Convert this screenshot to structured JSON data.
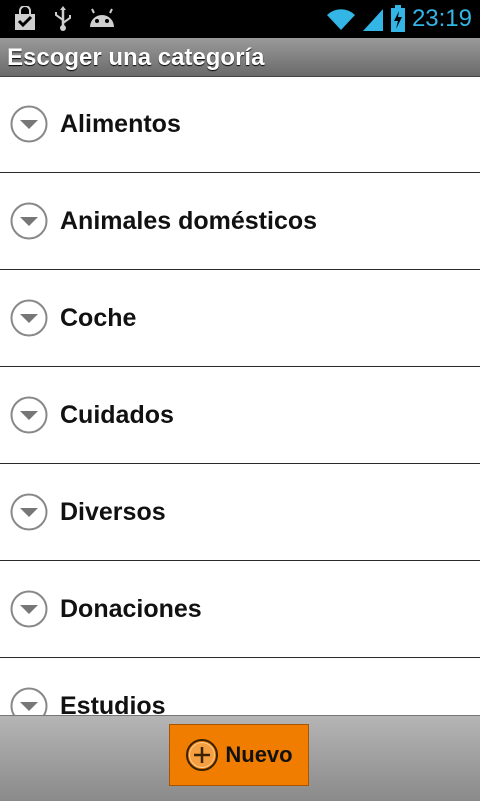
{
  "status_bar": {
    "time": "23:19",
    "icons": [
      "shopping-bag-icon",
      "usb-icon",
      "android-debug-icon",
      "wifi-icon",
      "signal-icon",
      "battery-charging-icon"
    ],
    "accent_color": "#33b5e5"
  },
  "title_bar": {
    "title": "Escoger una categoría"
  },
  "categories": [
    {
      "label": "Alimentos",
      "icon": "chevron-down-circle-icon"
    },
    {
      "label": "Animales domésticos",
      "icon": "chevron-down-circle-icon"
    },
    {
      "label": "Coche",
      "icon": "chevron-down-circle-icon"
    },
    {
      "label": "Cuidados",
      "icon": "chevron-down-circle-icon"
    },
    {
      "label": "Diversos",
      "icon": "chevron-down-circle-icon"
    },
    {
      "label": "Donaciones",
      "icon": "chevron-down-circle-icon"
    },
    {
      "label": "Estudios",
      "icon": "chevron-down-circle-icon"
    }
  ],
  "bottom_bar": {
    "new_button_label": "Nuevo",
    "new_button_icon": "plus-circle-icon",
    "new_button_color": "#f07d00"
  }
}
